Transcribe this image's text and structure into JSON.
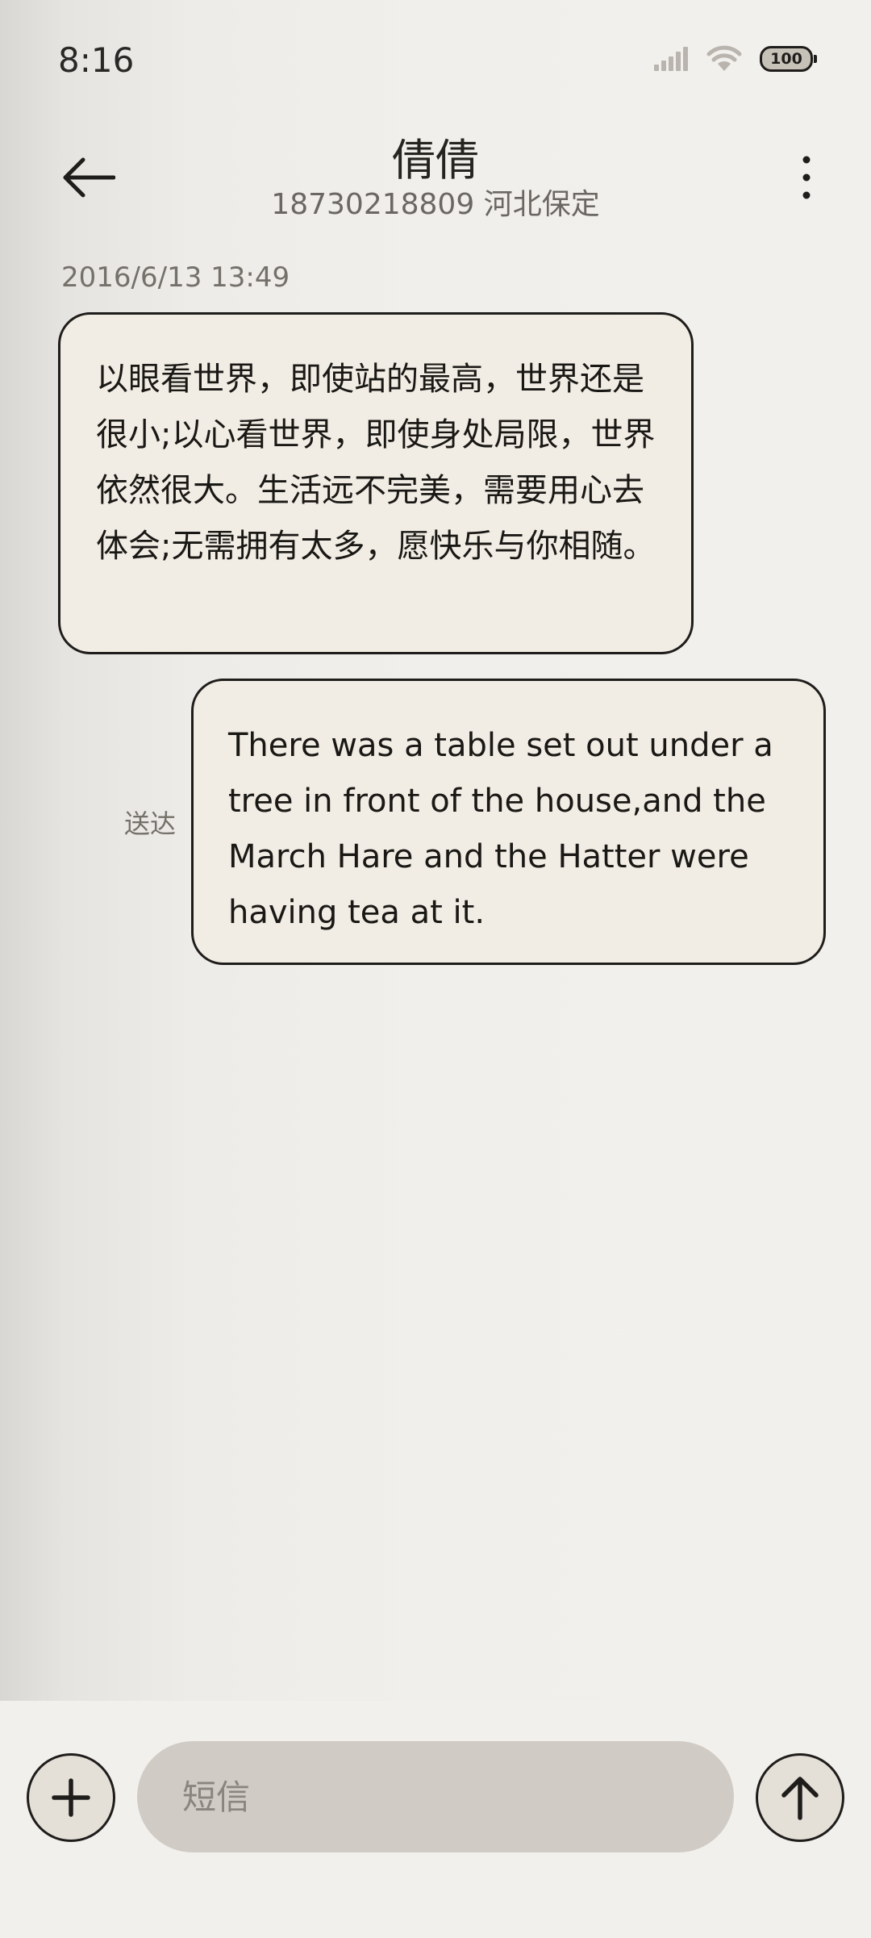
{
  "status_bar": {
    "time": "8:16",
    "battery_level": "100",
    "icons": [
      "signal-icon",
      "wifi-icon",
      "battery-icon"
    ]
  },
  "header": {
    "contact_name": "倩倩",
    "contact_number_location": "18730218809 河北保定",
    "icons": [
      "back-arrow-icon",
      "more-vertical-icon"
    ]
  },
  "conversation": {
    "timestamp": "2016/6/13 13:49",
    "messages": [
      {
        "direction": "incoming",
        "text": "以眼看世界，即使站的最高，世界还是很小;以心看世界，即使身处局限，世界依然很大。生活远不完美，需要用心去体会;无需拥有太多，愿快乐与你相随。"
      },
      {
        "direction": "outgoing",
        "text": "There was a table set out under a tree in front of the house,and the March Hare and the Hatter were having tea at it.",
        "status": "送达"
      }
    ]
  },
  "composer": {
    "placeholder": "短信",
    "value": "",
    "icons": [
      "plus-icon",
      "send-arrow-up-icon"
    ]
  },
  "colors": {
    "bubble_fill": "#f1ede4",
    "bubble_border": "#1f1d1b",
    "input_fill": "#d0cbc4",
    "secondary_text": "#74706a"
  }
}
